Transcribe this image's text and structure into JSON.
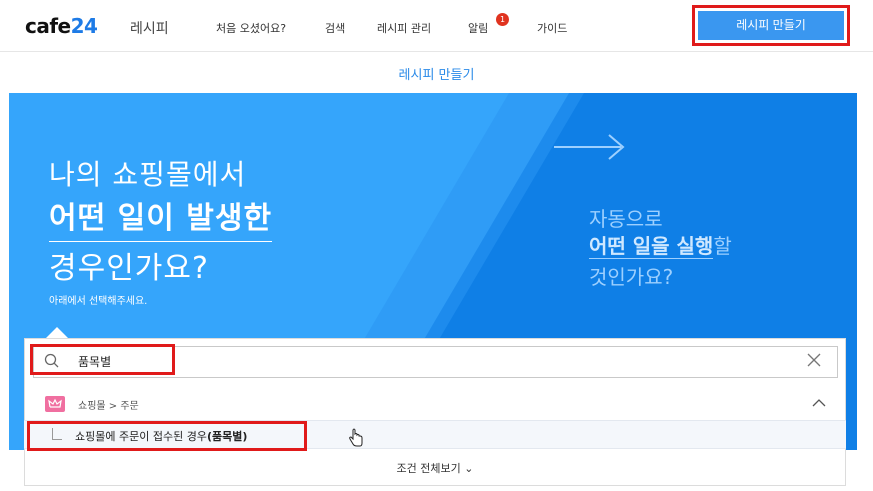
{
  "header": {
    "logo_main": "cafe",
    "logo_num": "24",
    "logo_sub": "레시피",
    "nav": [
      {
        "label": "처음 오셨어요?"
      },
      {
        "label": "검색"
      },
      {
        "label": "레시피 관리"
      },
      {
        "label": "알림"
      },
      {
        "label": "가이드"
      }
    ],
    "notification_count": "1",
    "create_button": "레시피 만들기"
  },
  "page": {
    "subtitle": "레시피 만들기"
  },
  "banner": {
    "left_line1": "나의 쇼핑몰에서",
    "left_line2": "어떤 일이 발생한",
    "left_line3": "경우인가요?",
    "left_hint": "아래에서 선택해주세요.",
    "right_line1": "자동으로",
    "right_line2_a": "어떤 일을 실행",
    "right_line2_b": "할",
    "right_line3": "것인가요?"
  },
  "search": {
    "value": "품목별",
    "category": "쇼핑몰 > 주문",
    "result_prefix": "쇼핑몰에 주문이 접수된 경우",
    "result_highlight": "(품목별)",
    "view_all": "조건 전체보기"
  },
  "colors": {
    "accent": "#3a97f0",
    "highlight_border": "#e01a1a",
    "category_icon": "#f06fa0"
  }
}
